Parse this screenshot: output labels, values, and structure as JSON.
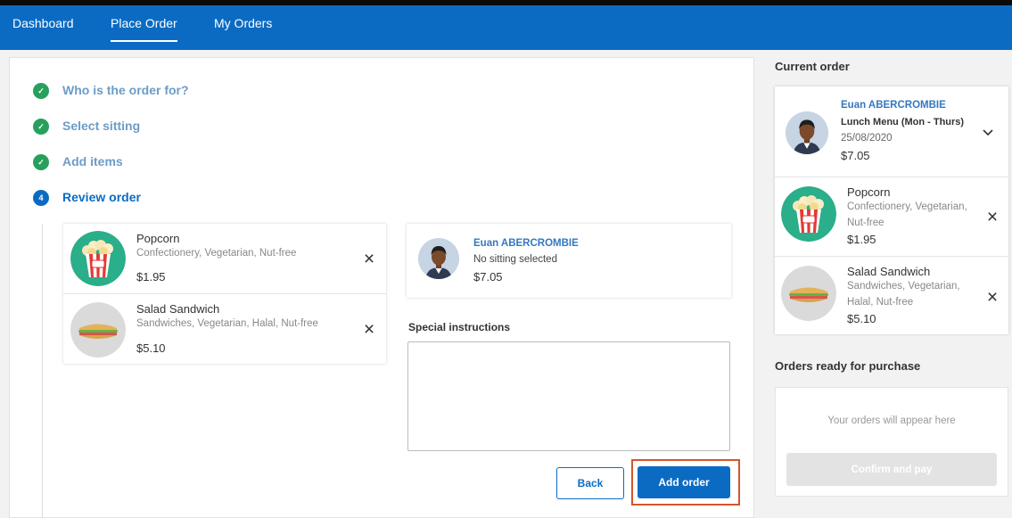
{
  "nav": {
    "items": [
      {
        "label": "Dashboard"
      },
      {
        "label": "Place Order"
      },
      {
        "label": "My Orders"
      }
    ],
    "color": "#0b6bc3"
  },
  "steps": [
    {
      "label": "Who is the order for?",
      "status": "done"
    },
    {
      "label": "Select sitting",
      "status": "done"
    },
    {
      "label": "Add items",
      "status": "done"
    },
    {
      "label": "Review order",
      "status": "current",
      "number": "4"
    }
  ],
  "review": {
    "items": [
      {
        "name": "Popcorn",
        "tags": "Confectionery, Vegetarian, Nut-free",
        "price": "$1.95",
        "icon": "popcorn-icon"
      },
      {
        "name": "Salad Sandwich",
        "tags": "Sandwiches, Vegetarian, Halal, Nut-free",
        "price": "$5.10",
        "icon": "sandwich-icon"
      }
    ],
    "person": {
      "name": "Euan ABERCROMBIE",
      "sitting": "No sitting selected",
      "total": "$7.05"
    },
    "special_instructions_label": "Special instructions",
    "special_instructions_value": "",
    "back_label": "Back",
    "add_label": "Add order"
  },
  "current_order": {
    "title": "Current order",
    "person_name": "Euan ABERCROMBIE",
    "menu": "Lunch Menu (Mon - Thurs)",
    "date": "25/08/2020",
    "total": "$7.05",
    "items": [
      {
        "name": "Popcorn",
        "tags_line1": "Confectionery, Vegetarian,",
        "tags_line2": "Nut-free",
        "price": "$1.95"
      },
      {
        "name": "Salad Sandwich",
        "tags_line1": "Sandwiches, Vegetarian,",
        "tags_line2": "Halal, Nut-free",
        "price": "$5.10"
      }
    ]
  },
  "ready": {
    "title": "Orders ready for purchase",
    "empty_text": "Your orders will appear here",
    "confirm_label": "Confirm and pay"
  }
}
